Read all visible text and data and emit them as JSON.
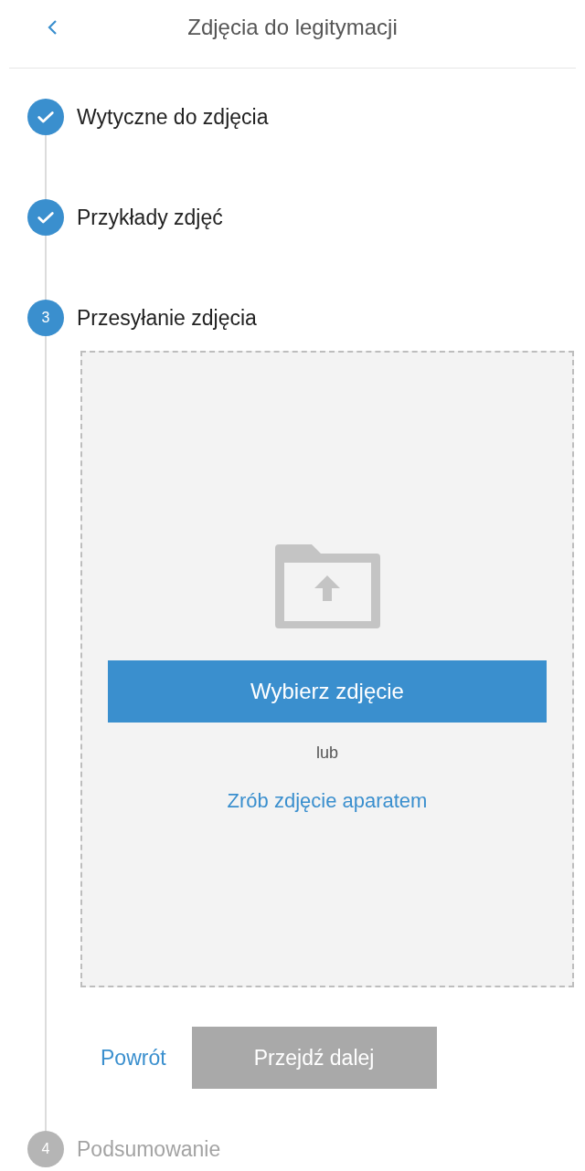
{
  "header": {
    "title": "Zdjęcia do legitymacji"
  },
  "steps": [
    {
      "kind": "done",
      "label": "Wytyczne do zdjęcia"
    },
    {
      "kind": "done",
      "label": "Przykłady zdjęć"
    },
    {
      "kind": "active",
      "number": "3",
      "label": "Przesyłanie zdjęcia",
      "upload": {
        "choose_button": "Wybierz zdjęcie",
        "or": "lub",
        "camera_link": "Zrób zdjęcie aparatem"
      },
      "back_link": "Powrót",
      "next_button": {
        "label": "Przejdź dalej",
        "disabled": true
      }
    },
    {
      "kind": "pending",
      "number": "4",
      "label": "Podsumowanie"
    }
  ]
}
